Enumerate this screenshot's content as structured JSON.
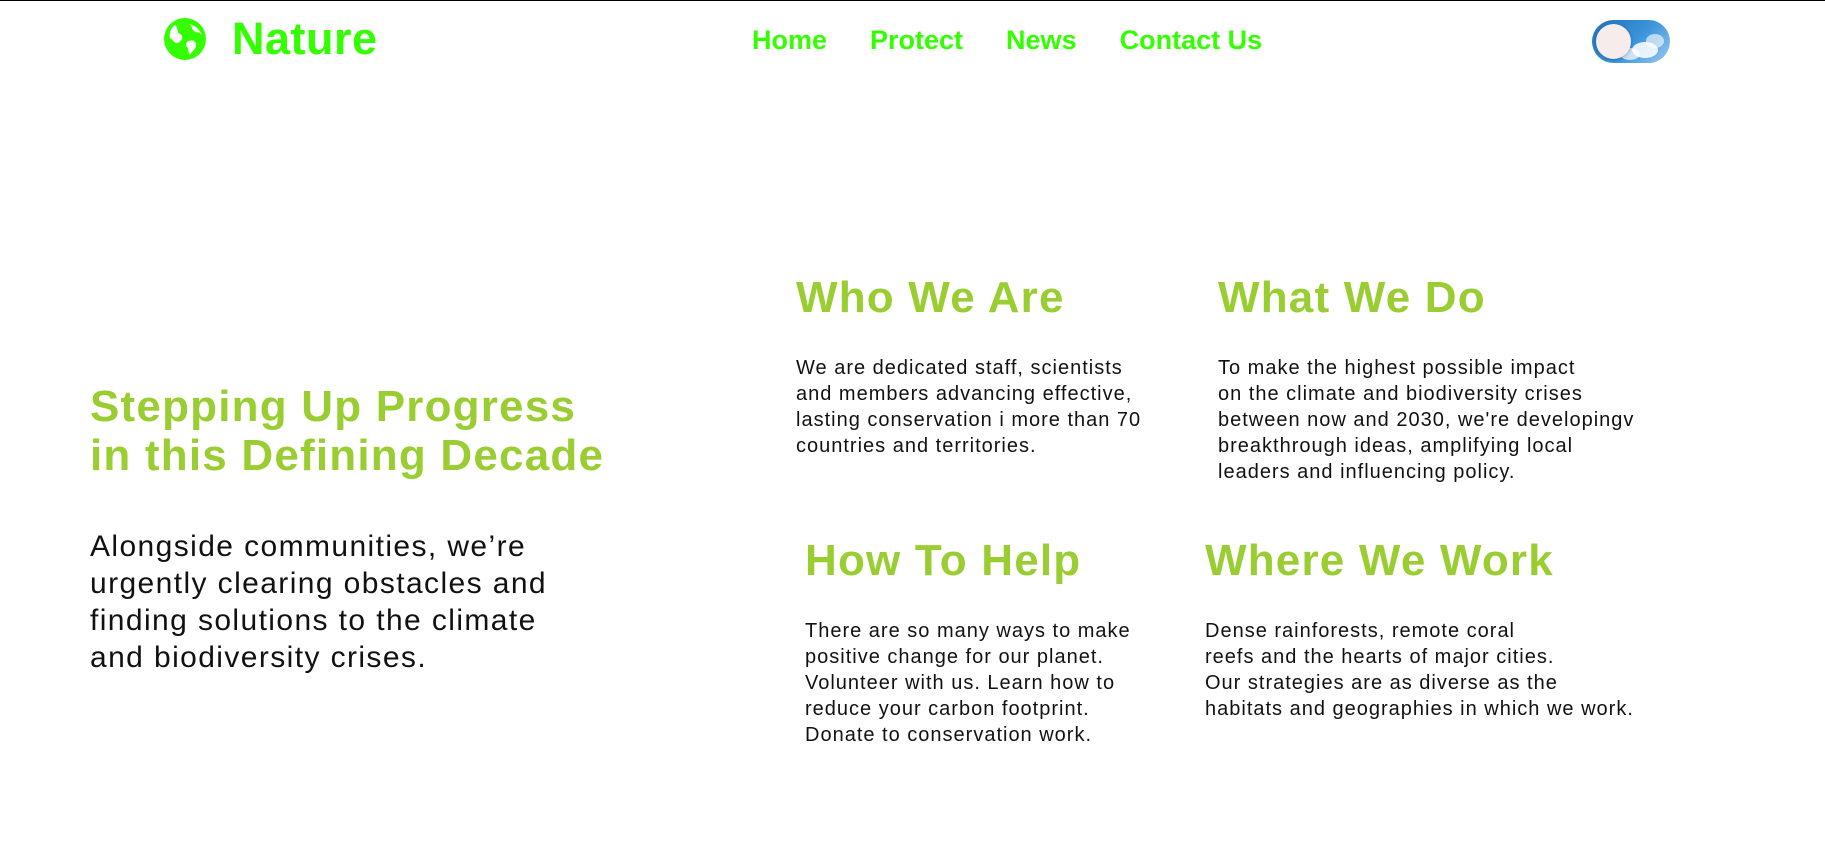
{
  "brand": {
    "name": "Nature",
    "icon": "globe-icon",
    "color": "#33ff00"
  },
  "nav": {
    "items": [
      {
        "label": "Home"
      },
      {
        "label": "Protect"
      },
      {
        "label": "News"
      },
      {
        "label": "Contact Us"
      }
    ]
  },
  "theme_toggle": {
    "icon": "sky-toggle",
    "state": "off"
  },
  "hero": {
    "title_line1": "Stepping Up Progress",
    "title_line2": "in this Defining Decade",
    "text_line1": "Alongside communities, we’re",
    "text_line2": "urgently clearing obstacles and",
    "text_line3": "finding solutions to the climate",
    "text_line4": "and biodiversity crises."
  },
  "cards": [
    {
      "title": "Who We Are",
      "lines": [
        "We are dedicated staff, scientists",
        "and members advancing effective,",
        "lasting conservation i more than 70",
        "countries and territories."
      ]
    },
    {
      "title": "What We Do",
      "lines": [
        "To make the highest possible impact",
        "on the climate and biodiversity crises",
        "between now and 2030, we're developingv",
        "breakthrough ideas, amplifying local",
        "leaders and influencing policy."
      ]
    },
    {
      "title": "How To Help",
      "lines": [
        "There are so many ways to make",
        "positive change for our planet.",
        "Volunteer with us. Learn how to",
        "reduce your carbon footprint.",
        "Donate to conservation work."
      ]
    },
    {
      "title": "Where We Work",
      "lines": [
        "Dense rainforests, remote coral",
        "reefs and the hearts of major cities.",
        "Our strategies are as diverse as the",
        "habitats and geographies in which we work."
      ]
    }
  ],
  "colors": {
    "nav_accent": "#33ff00",
    "heading_green": "#9acd32",
    "body_text": "#111111",
    "toggle_blue": "#2a7fc9"
  }
}
